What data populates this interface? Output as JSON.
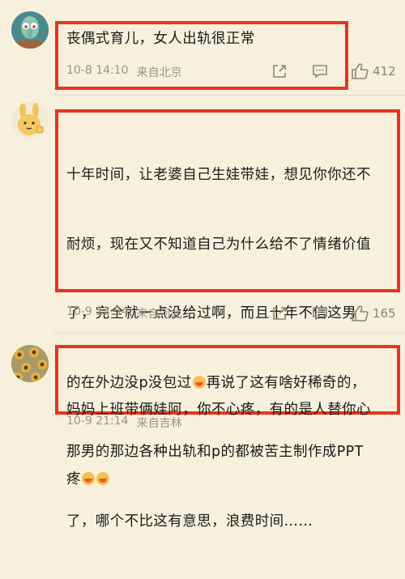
{
  "comments": [
    {
      "text": "丧偶式育儿，女人出轨很正常",
      "date": "10-8 14:10",
      "location": "来自北京",
      "likes": "412"
    },
    {
      "text_lines": [
        "十年时间，让老婆自己生娃带娃，想见你你还不",
        "耐烦，现在又不知道自己为什么给不了情绪价值",
        "了，完全就一点没给过啊，而且十年不信这男",
        "的在外边没p没包过",
        "再说了这有啥好稀奇的，",
        "那男的那边各种出轨和p的都被苦主制作成PPT",
        "了，哪个不比这有意思，浪费时间……"
      ],
      "date": "10-9 12:54",
      "location": "来自河北",
      "likes": "165"
    },
    {
      "text_lines": [
        "妈妈上班带俩娃阿，你不心疼，有的是人替你心",
        "疼"
      ],
      "date": "10-9 21:14",
      "location": "来自吉林"
    }
  ],
  "icons": {
    "share": "share-icon",
    "comment": "comment-icon",
    "like": "thumbs-up-icon",
    "emoji": "laughing-emoji-icon",
    "emoji_blush": "blushing-emoji-icon"
  },
  "colors": {
    "background": "#f7f0dc",
    "highlight_border": "#e8331f",
    "meta_text": "#9a9486"
  }
}
